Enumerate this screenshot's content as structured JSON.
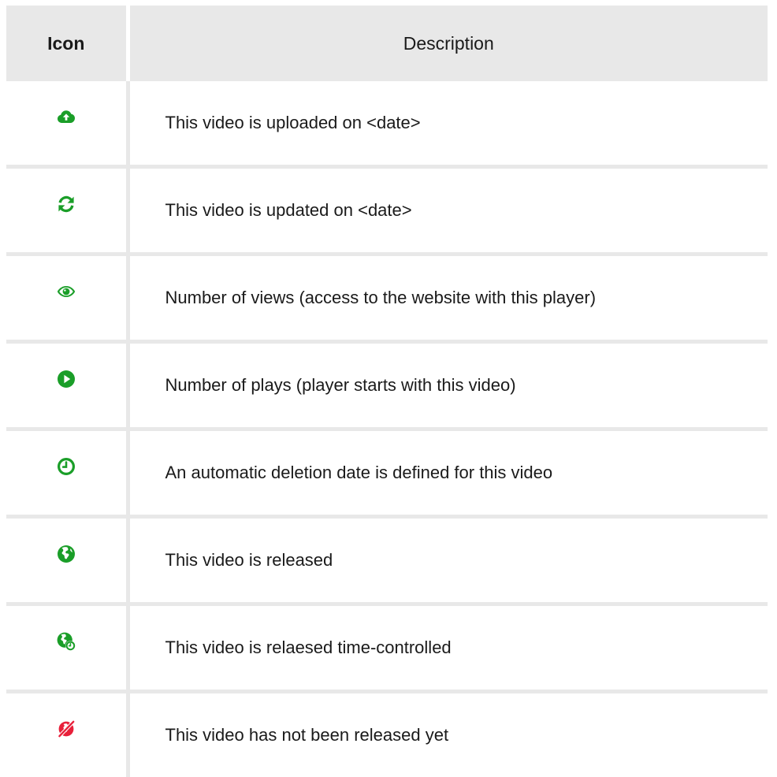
{
  "table": {
    "header": {
      "icon": "Icon",
      "description": "Description"
    },
    "rows": [
      {
        "icon": "cloud-upload-icon",
        "description": "This video is uploaded on <date>"
      },
      {
        "icon": "refresh-icon",
        "description": "This video is updated on <date>"
      },
      {
        "icon": "eye-icon",
        "description": "Number of views (access to the website with this player)"
      },
      {
        "icon": "play-circle-icon",
        "description": "Number of plays (player starts with this video)"
      },
      {
        "icon": "clock-icon",
        "description": "An automatic deletion date is defined for this video"
      },
      {
        "icon": "globe-icon",
        "description": "This video is released"
      },
      {
        "icon": "globe-clock-icon",
        "description": "This video is relaesed time-controlled"
      },
      {
        "icon": "unreleased-icon",
        "description": "This video has not been released yet"
      }
    ]
  },
  "colors": {
    "icon_green": "#1a9e28",
    "icon_red": "#e8203a",
    "header_bg": "#e8e8e8",
    "border": "#e8e8e8"
  }
}
